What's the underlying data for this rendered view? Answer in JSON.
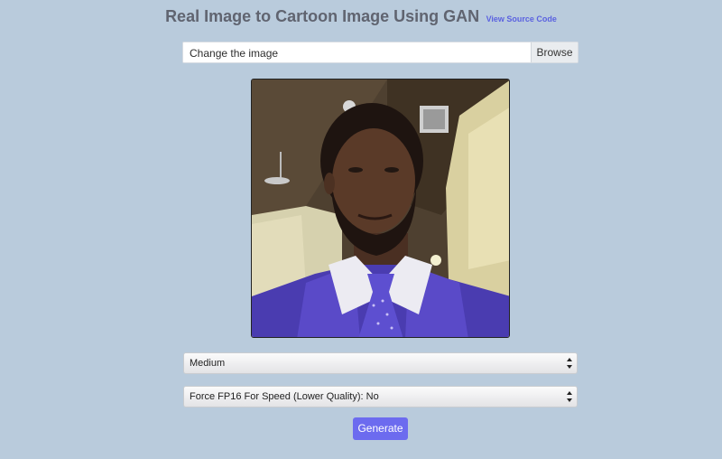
{
  "header": {
    "title": "Real Image to Cartoon Image Using GAN",
    "source_link": "View Source Code"
  },
  "upload": {
    "file_label": "Change the image",
    "browse_label": "Browse"
  },
  "preview": {
    "icon": "uploaded-photo"
  },
  "options": {
    "quality_selected": "Medium",
    "fp16_selected": "Force FP16 For Speed (Lower Quality): No"
  },
  "actions": {
    "generate_label": "Generate"
  },
  "colors": {
    "background": "#b9cbdc",
    "accent": "#6c6bef",
    "link": "#5b62e0"
  }
}
